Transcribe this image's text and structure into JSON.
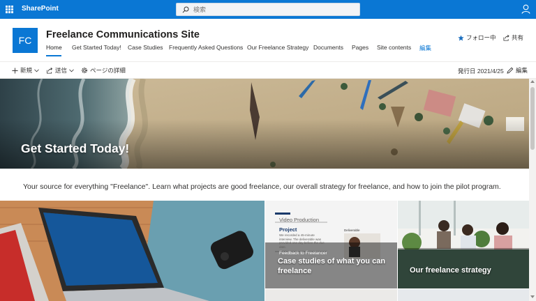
{
  "suite": {
    "app_name": "SharePoint",
    "search_placeholder": "検索"
  },
  "site": {
    "logo_text": "FC",
    "title": "Freelance Communications Site",
    "follow_label": "フォロー中",
    "share_label": "共有",
    "nav": [
      {
        "label": "Home",
        "active": true
      },
      {
        "label": "Get Started Today!"
      },
      {
        "label": "Case Studies"
      },
      {
        "label": "Frequently Asked Questions"
      },
      {
        "label": "Our Freelance Strategy"
      },
      {
        "label": "Documents"
      },
      {
        "label": "Pages"
      },
      {
        "label": "Site contents"
      },
      {
        "label": "編集"
      }
    ]
  },
  "command_bar": {
    "new_label": "新規",
    "send_label": "送信",
    "page_details_label": "ページの詳細",
    "published_label": "発行日 2021/4/25",
    "edit_label": "編集"
  },
  "hero": {
    "title": "Get Started Today!"
  },
  "intro": {
    "text": "Your source for everything \"Freelance\". Learn what projects are good freelance, our overall strategy for freelance, and how to join the pilot program."
  },
  "tiles": {
    "case_studies": {
      "caption": "Case studies of what you can freelance",
      "mock_header": "Video Production",
      "mock_project": "Project",
      "mock_body": "We recorded a 45-minute interview. The deliverable was provided one day before the due date.",
      "mock_deliverable": "Deliverable",
      "mock_feedback": "Feedback to Freelancer"
    },
    "strategy": {
      "caption": "Our freelance strategy"
    }
  },
  "colors": {
    "suite_blue": "#0a77d4",
    "text": "#323130"
  },
  "icons": [
    "waffle-icon",
    "search-icon",
    "user-icon",
    "star-icon",
    "share-icon",
    "plus-icon",
    "send-icon",
    "gear-icon",
    "pencil-icon",
    "chevron-down-icon"
  ]
}
